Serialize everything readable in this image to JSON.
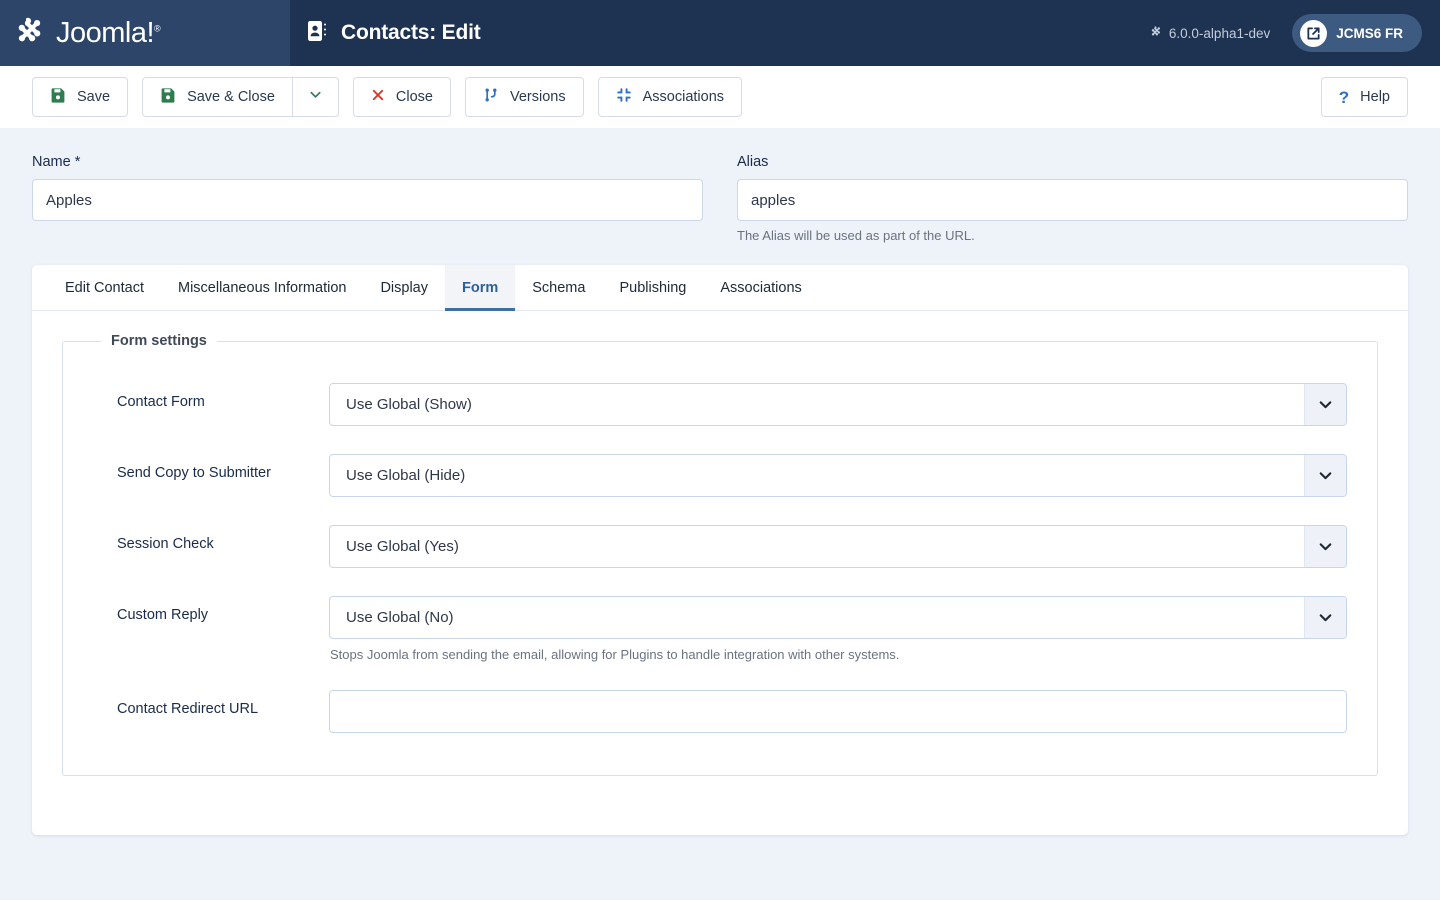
{
  "header": {
    "brand": "Joomla!",
    "brand_trademark": "®",
    "brand_icon": "joomla-logo-icon",
    "title": "Contacts: Edit",
    "title_icon": "contact-card-icon",
    "version": "6.0.0-alpha1-dev",
    "version_icon": "joomla-mark-icon",
    "site_link_label": "JCMS6 FR",
    "site_link_icon": "external-link-icon"
  },
  "toolbar": {
    "save_label": "Save",
    "save_icon": "floppy-disk-icon",
    "save_close_label": "Save & Close",
    "save_close_icon": "floppy-disk-icon",
    "save_close_toggle_icon": "chevron-down-icon",
    "close_label": "Close",
    "close_icon": "x-icon",
    "versions_label": "Versions",
    "versions_icon": "code-branch-icon",
    "associations_label": "Associations",
    "associations_icon": "compress-arrows-icon",
    "help_label": "Help",
    "help_icon": "question-mark-icon"
  },
  "top_fields": {
    "name_label": "Name *",
    "name_value": "Apples",
    "alias_label": "Alias",
    "alias_value": "apples",
    "alias_hint": "The Alias will be used as part of the URL."
  },
  "tabs": [
    {
      "label": "Edit Contact",
      "active": false
    },
    {
      "label": "Miscellaneous Information",
      "active": false
    },
    {
      "label": "Display",
      "active": false
    },
    {
      "label": "Form",
      "active": true
    },
    {
      "label": "Schema",
      "active": false
    },
    {
      "label": "Publishing",
      "active": false
    },
    {
      "label": "Associations",
      "active": false
    }
  ],
  "form_settings": {
    "legend": "Form settings",
    "rows": [
      {
        "label": "Contact Form",
        "type": "select",
        "value": "Use Global (Show)",
        "hint": "",
        "arrow_icon": "chevron-down-icon"
      },
      {
        "label": "Send Copy to Submitter",
        "type": "select",
        "value": "Use Global (Hide)",
        "hint": "",
        "arrow_icon": "chevron-down-icon"
      },
      {
        "label": "Session Check",
        "type": "select",
        "value": "Use Global (Yes)",
        "hint": "",
        "arrow_icon": "chevron-down-icon"
      },
      {
        "label": "Custom Reply",
        "type": "select",
        "value": "Use Global (No)",
        "hint": "Stops Joomla from sending the email, allowing for Plugins to handle integration with other systems.",
        "arrow_icon": "chevron-down-icon"
      },
      {
        "label": "Contact Redirect URL",
        "type": "text",
        "value": "",
        "placeholder": "",
        "hint": ""
      }
    ]
  },
  "colors": {
    "header_bg": "#1e3252",
    "logo_pane_bg": "#2c4568",
    "page_bg": "#eef2f9",
    "accent_blue": "#3b6fa8",
    "save_green": "#2f7d4f",
    "close_red": "#d9372b",
    "icon_blue": "#2f6fc4"
  }
}
